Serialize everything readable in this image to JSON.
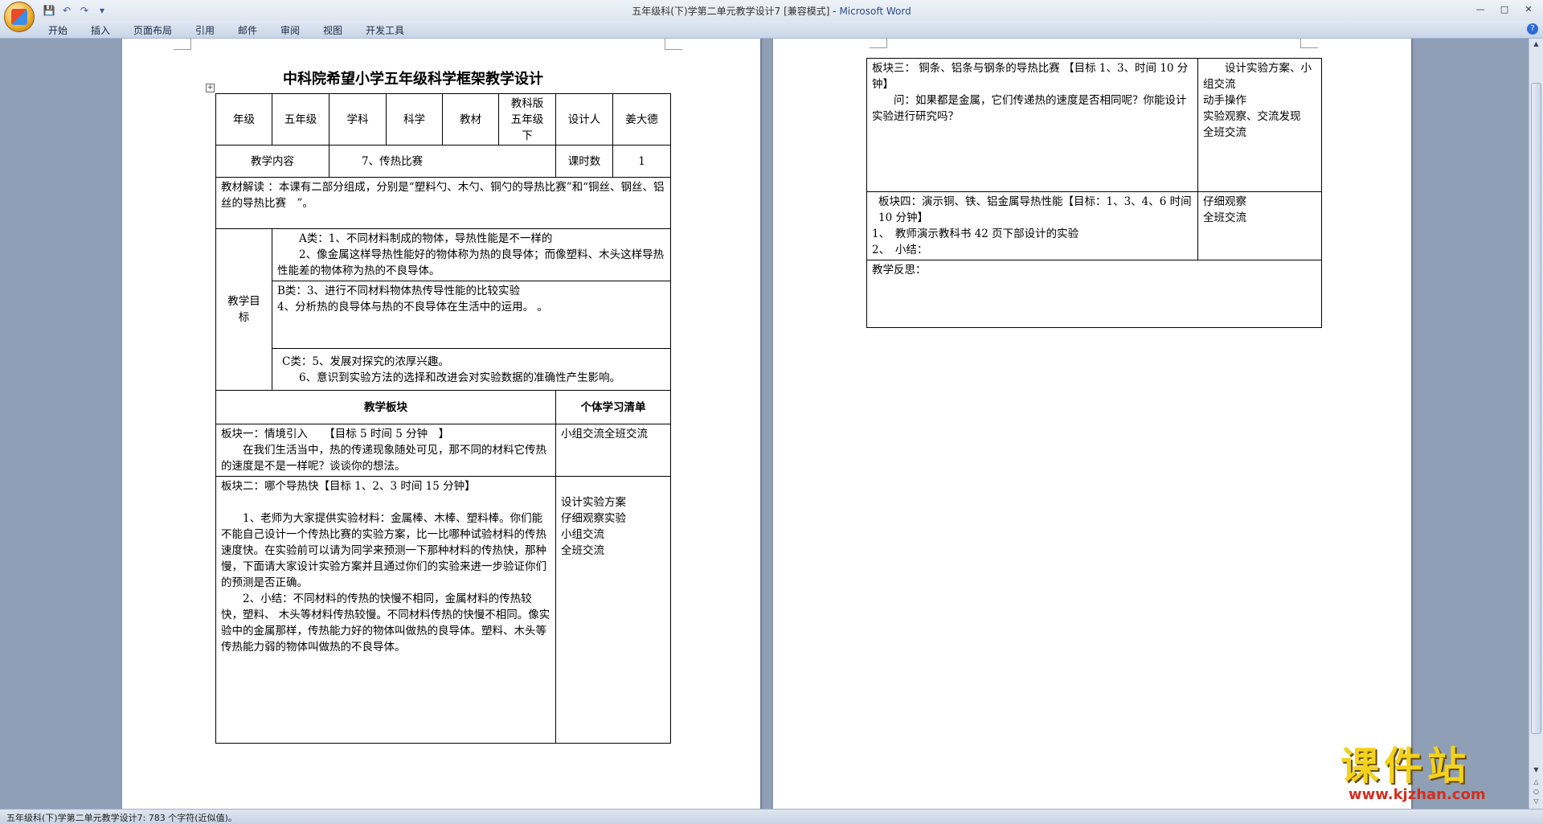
{
  "window": {
    "title": "五年级科(下)学第二单元教学设计7 [兼容模式]",
    "title_sep": " - ",
    "app": "Microsoft Word"
  },
  "quick_access": {
    "save_icon": "save-icon",
    "undo_icon": "undo-icon",
    "redo_icon": "redo-icon",
    "customize_icon": "dropdown-icon"
  },
  "ribbon_tabs": [
    "开始",
    "插入",
    "页面布局",
    "引用",
    "邮件",
    "审阅",
    "视图",
    "开发工具"
  ],
  "help_glyph": "?",
  "status": {
    "text": "五年级科(下)学第二单元教学设计7: 783 个字符(近似值)。"
  },
  "watermark": {
    "brand": "课件站",
    "url": "www.kjzhan.com"
  },
  "doc": {
    "title": "中科院希望小学五年级科学框架教学设计",
    "header_row": {
      "grade_label": "年级",
      "grade_value": "五年级",
      "subject_label": "学科",
      "subject_value": "科学",
      "textbook_label": "教材",
      "textbook_value": "教科版五年级下",
      "designer_label": "设计人",
      "designer_value": "姜大德"
    },
    "content_row": {
      "label": "教学内容",
      "value": "7、传热比赛",
      "hours_label": "课时数",
      "hours_value": "1"
    },
    "analysis": "教材解读 ：本课有二部分组成，分别是“塑料勺、木勺、铜勺的导热比赛”和“铜丝、钢丝、铝丝的导热比赛　”。",
    "goals": {
      "label": "教学目标",
      "a1": "A类：1、不同材料制成的物体，导热性能是不一样的",
      "a2": "2、像金属这样导热性能好的物体称为热的良导体；而像塑料、木头这样导热性能差的物体称为热的不良导体。",
      "b1": "B类：3、进行不同材料物体热传导性能的比较实验",
      "b2": "4、分析热的良导体与热的不良导体在生活中的运用。 。",
      "c1": "C类：5、发展对探究的浓厚兴趣。",
      "c2": "6、意识到实验方法的选择和改进会对实验数据的准确性产生影响。"
    },
    "blocks_header": {
      "left": "教学板块",
      "right": "个体学习清单"
    },
    "block1": {
      "title": "板块一：情境引入　　【目标 5 时间 5 分钟　】",
      "text": "在我们生活当中，热的传递现象随处可见，那不同的材料它传热的速度是不是一样呢？谈谈你的想法。",
      "list": "小组交流全班交流"
    },
    "block2": {
      "title": "板块二：哪个导热快【目标 1、2、3 时间 15 分钟】",
      "p1": "1、老师为大家提供实验材料：金属棒、木棒、塑料棒。你们能不能自己设计一个传热比赛的实验方案，比一比哪种试验材料的传热速度快。在实验前可以请为同学来预测一下那种材料的传热快，那种慢，下面请大家设计实验方案并且通过你们的实验来进一步验证你们的预测是否正确。",
      "p2": "2、小结：不同材料的传热的快慢不相同，金属材料的传热较快，塑料、 木头等材料传热较慢。不同材料传热的快慢不相同。像实验中的金属那样，传热能力好的物体叫做热的良导体。塑料、木头等传热能力弱的物体叫做热的不良导体。",
      "list": [
        "设计实验方案",
        "仔细观察实验",
        "小组交流",
        "全班交流"
      ]
    },
    "block3": {
      "title": "板块三： 铜条、铝条与钢条的导热比赛 【目标 1、3、时间 10 分钟】",
      "text": "问：如果都是金属，它们传递热的速度是否相同呢？你能设计实验进行研究吗？",
      "list": [
        "设计实验方案、小组交流",
        "动手操作",
        "实验观察、交流发现",
        "全班交流"
      ]
    },
    "block4": {
      "title": "板块四：演示铜、铁、铝金属导热性能【目标：1、3、4、6 时间 10 分钟】",
      "i1": "1、　教师演示教科书 42 页下部设计的实验",
      "i2": "2、　小结：",
      "list": [
        "仔细观察",
        "全班交流"
      ]
    },
    "reflection": "教学反思："
  }
}
